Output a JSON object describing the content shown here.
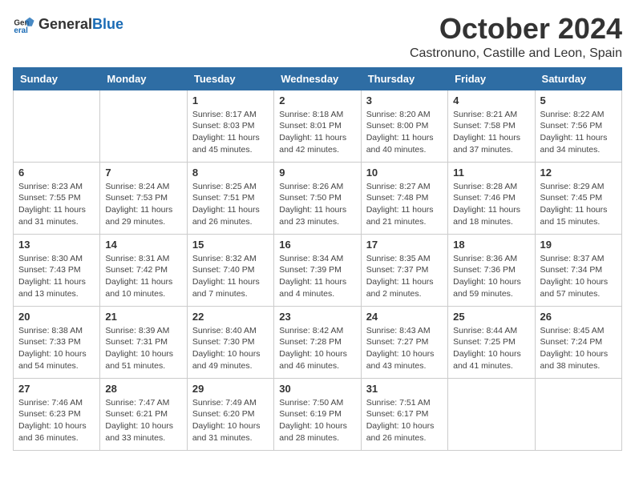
{
  "header": {
    "logo_general": "General",
    "logo_blue": "Blue",
    "month": "October 2024",
    "location": "Castronuno, Castille and Leon, Spain"
  },
  "days_of_week": [
    "Sunday",
    "Monday",
    "Tuesday",
    "Wednesday",
    "Thursday",
    "Friday",
    "Saturday"
  ],
  "weeks": [
    [
      {
        "day": "",
        "info": ""
      },
      {
        "day": "",
        "info": ""
      },
      {
        "day": "1",
        "info": "Sunrise: 8:17 AM\nSunset: 8:03 PM\nDaylight: 11 hours and 45 minutes."
      },
      {
        "day": "2",
        "info": "Sunrise: 8:18 AM\nSunset: 8:01 PM\nDaylight: 11 hours and 42 minutes."
      },
      {
        "day": "3",
        "info": "Sunrise: 8:20 AM\nSunset: 8:00 PM\nDaylight: 11 hours and 40 minutes."
      },
      {
        "day": "4",
        "info": "Sunrise: 8:21 AM\nSunset: 7:58 PM\nDaylight: 11 hours and 37 minutes."
      },
      {
        "day": "5",
        "info": "Sunrise: 8:22 AM\nSunset: 7:56 PM\nDaylight: 11 hours and 34 minutes."
      }
    ],
    [
      {
        "day": "6",
        "info": "Sunrise: 8:23 AM\nSunset: 7:55 PM\nDaylight: 11 hours and 31 minutes."
      },
      {
        "day": "7",
        "info": "Sunrise: 8:24 AM\nSunset: 7:53 PM\nDaylight: 11 hours and 29 minutes."
      },
      {
        "day": "8",
        "info": "Sunrise: 8:25 AM\nSunset: 7:51 PM\nDaylight: 11 hours and 26 minutes."
      },
      {
        "day": "9",
        "info": "Sunrise: 8:26 AM\nSunset: 7:50 PM\nDaylight: 11 hours and 23 minutes."
      },
      {
        "day": "10",
        "info": "Sunrise: 8:27 AM\nSunset: 7:48 PM\nDaylight: 11 hours and 21 minutes."
      },
      {
        "day": "11",
        "info": "Sunrise: 8:28 AM\nSunset: 7:46 PM\nDaylight: 11 hours and 18 minutes."
      },
      {
        "day": "12",
        "info": "Sunrise: 8:29 AM\nSunset: 7:45 PM\nDaylight: 11 hours and 15 minutes."
      }
    ],
    [
      {
        "day": "13",
        "info": "Sunrise: 8:30 AM\nSunset: 7:43 PM\nDaylight: 11 hours and 13 minutes."
      },
      {
        "day": "14",
        "info": "Sunrise: 8:31 AM\nSunset: 7:42 PM\nDaylight: 11 hours and 10 minutes."
      },
      {
        "day": "15",
        "info": "Sunrise: 8:32 AM\nSunset: 7:40 PM\nDaylight: 11 hours and 7 minutes."
      },
      {
        "day": "16",
        "info": "Sunrise: 8:34 AM\nSunset: 7:39 PM\nDaylight: 11 hours and 4 minutes."
      },
      {
        "day": "17",
        "info": "Sunrise: 8:35 AM\nSunset: 7:37 PM\nDaylight: 11 hours and 2 minutes."
      },
      {
        "day": "18",
        "info": "Sunrise: 8:36 AM\nSunset: 7:36 PM\nDaylight: 10 hours and 59 minutes."
      },
      {
        "day": "19",
        "info": "Sunrise: 8:37 AM\nSunset: 7:34 PM\nDaylight: 10 hours and 57 minutes."
      }
    ],
    [
      {
        "day": "20",
        "info": "Sunrise: 8:38 AM\nSunset: 7:33 PM\nDaylight: 10 hours and 54 minutes."
      },
      {
        "day": "21",
        "info": "Sunrise: 8:39 AM\nSunset: 7:31 PM\nDaylight: 10 hours and 51 minutes."
      },
      {
        "day": "22",
        "info": "Sunrise: 8:40 AM\nSunset: 7:30 PM\nDaylight: 10 hours and 49 minutes."
      },
      {
        "day": "23",
        "info": "Sunrise: 8:42 AM\nSunset: 7:28 PM\nDaylight: 10 hours and 46 minutes."
      },
      {
        "day": "24",
        "info": "Sunrise: 8:43 AM\nSunset: 7:27 PM\nDaylight: 10 hours and 43 minutes."
      },
      {
        "day": "25",
        "info": "Sunrise: 8:44 AM\nSunset: 7:25 PM\nDaylight: 10 hours and 41 minutes."
      },
      {
        "day": "26",
        "info": "Sunrise: 8:45 AM\nSunset: 7:24 PM\nDaylight: 10 hours and 38 minutes."
      }
    ],
    [
      {
        "day": "27",
        "info": "Sunrise: 7:46 AM\nSunset: 6:23 PM\nDaylight: 10 hours and 36 minutes."
      },
      {
        "day": "28",
        "info": "Sunrise: 7:47 AM\nSunset: 6:21 PM\nDaylight: 10 hours and 33 minutes."
      },
      {
        "day": "29",
        "info": "Sunrise: 7:49 AM\nSunset: 6:20 PM\nDaylight: 10 hours and 31 minutes."
      },
      {
        "day": "30",
        "info": "Sunrise: 7:50 AM\nSunset: 6:19 PM\nDaylight: 10 hours and 28 minutes."
      },
      {
        "day": "31",
        "info": "Sunrise: 7:51 AM\nSunset: 6:17 PM\nDaylight: 10 hours and 26 minutes."
      },
      {
        "day": "",
        "info": ""
      },
      {
        "day": "",
        "info": ""
      }
    ]
  ]
}
